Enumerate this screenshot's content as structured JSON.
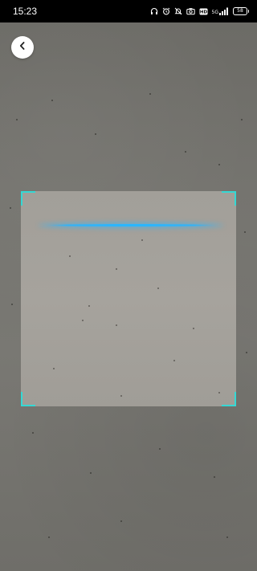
{
  "status_bar": {
    "time": "15:23",
    "network_label": "5G",
    "battery_level": "58",
    "icons": [
      "headphones-icon",
      "alarm-icon",
      "silent-icon",
      "camera-icon",
      "hd-icon",
      "signal-icon",
      "battery-icon"
    ]
  },
  "scanner": {
    "back_icon": "chevron-left-icon",
    "frame_corner_color": "#35d8d4",
    "scan_line_color": "#29b6ff"
  }
}
